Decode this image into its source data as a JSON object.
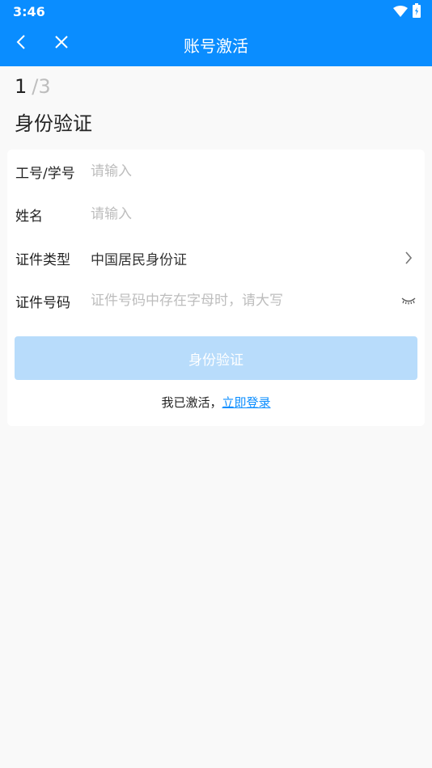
{
  "status": {
    "time": "3:46"
  },
  "nav": {
    "title": "账号激活",
    "back_icon": "chevron-left-icon",
    "close_icon": "close-icon"
  },
  "progress": {
    "current": "1",
    "total": "/3"
  },
  "section_title": "身份验证",
  "form": {
    "id_label": "工号/学号",
    "id_placeholder": "请输入",
    "name_label": "姓名",
    "name_placeholder": "请输入",
    "doc_type_label": "证件类型",
    "doc_type_value": "中国居民身份证",
    "doc_number_label": "证件号码",
    "doc_number_placeholder": "证件号码中存在字母时，请大写"
  },
  "submit_label": "身份验证",
  "login": {
    "prefix": "我已激活，",
    "link": "立即登录"
  },
  "colors": {
    "primary": "#0a8dff",
    "button_disabled": "#b8dcfb",
    "background": "#f9f9f9"
  }
}
